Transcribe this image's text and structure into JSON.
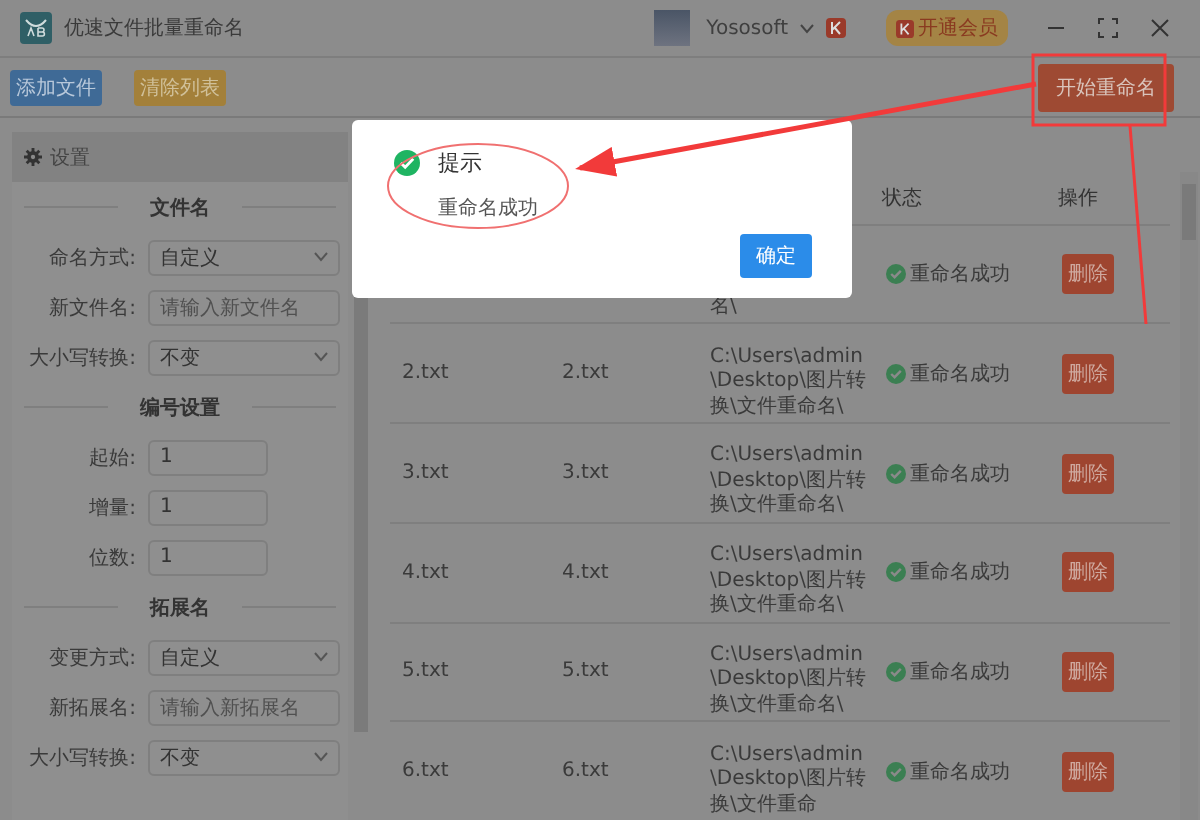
{
  "window": {
    "title": "优速文件批量重命名",
    "user": "Yososoft",
    "vip_button": "开通会员"
  },
  "toolbar": {
    "add_button": "添加文件",
    "clear_button": "清除列表",
    "start_button": "开始重命名"
  },
  "settings": {
    "title": "设置",
    "sections": [
      {
        "title": "文件名",
        "fields": [
          {
            "kind": "select",
            "label": "命名方式:",
            "value": "自定义"
          },
          {
            "kind": "input",
            "label": "新文件名:",
            "placeholder": "请输入新文件名"
          },
          {
            "kind": "select",
            "label": "大小写转换:",
            "value": "不变"
          }
        ]
      },
      {
        "title": "编号设置",
        "fields": [
          {
            "kind": "number",
            "label": "起始:",
            "value": "1"
          },
          {
            "kind": "number",
            "label": "增量:",
            "value": "1"
          },
          {
            "kind": "number",
            "label": "位数:",
            "value": "1"
          }
        ]
      },
      {
        "title": "拓展名",
        "fields": [
          {
            "kind": "select",
            "label": "变更方式:",
            "value": "自定义"
          },
          {
            "kind": "input",
            "label": "新拓展名:",
            "placeholder": "请输入新拓展名"
          },
          {
            "kind": "select",
            "label": "大小写转换:",
            "value": "不变"
          }
        ]
      }
    ]
  },
  "table": {
    "columns": [
      {
        "label": "状态"
      },
      {
        "label": "操作"
      }
    ],
    "rows": [
      {
        "path": "名\\",
        "status": "重命名成功",
        "action": "删除"
      },
      {
        "name": "2.txt",
        "new_name": "2.txt",
        "path": "C:\\Users\\admin\\Desktop\\图片转换\\文件重命名\\",
        "status": "重命名成功",
        "action": "删除"
      },
      {
        "name": "3.txt",
        "new_name": "3.txt",
        "path": "C:\\Users\\admin\\Desktop\\图片转换\\文件重命名\\",
        "status": "重命名成功",
        "action": "删除"
      },
      {
        "name": "4.txt",
        "new_name": "4.txt",
        "path": "C:\\Users\\admin\\Desktop\\图片转换\\文件重命名\\",
        "status": "重命名成功",
        "action": "删除"
      },
      {
        "name": "5.txt",
        "new_name": "5.txt",
        "path": "C:\\Users\\admin\\Desktop\\图片转换\\文件重命名\\",
        "status": "重命名成功",
        "action": "删除"
      },
      {
        "name": "6.txt",
        "new_name": "6.txt",
        "path": "C:\\Users\\admin\\Desktop\\图片转换\\文件重命",
        "status": "重命名成功",
        "action": "删除"
      }
    ]
  },
  "dialog": {
    "title": "提示",
    "message": "重命名成功",
    "ok_button": "确定"
  }
}
